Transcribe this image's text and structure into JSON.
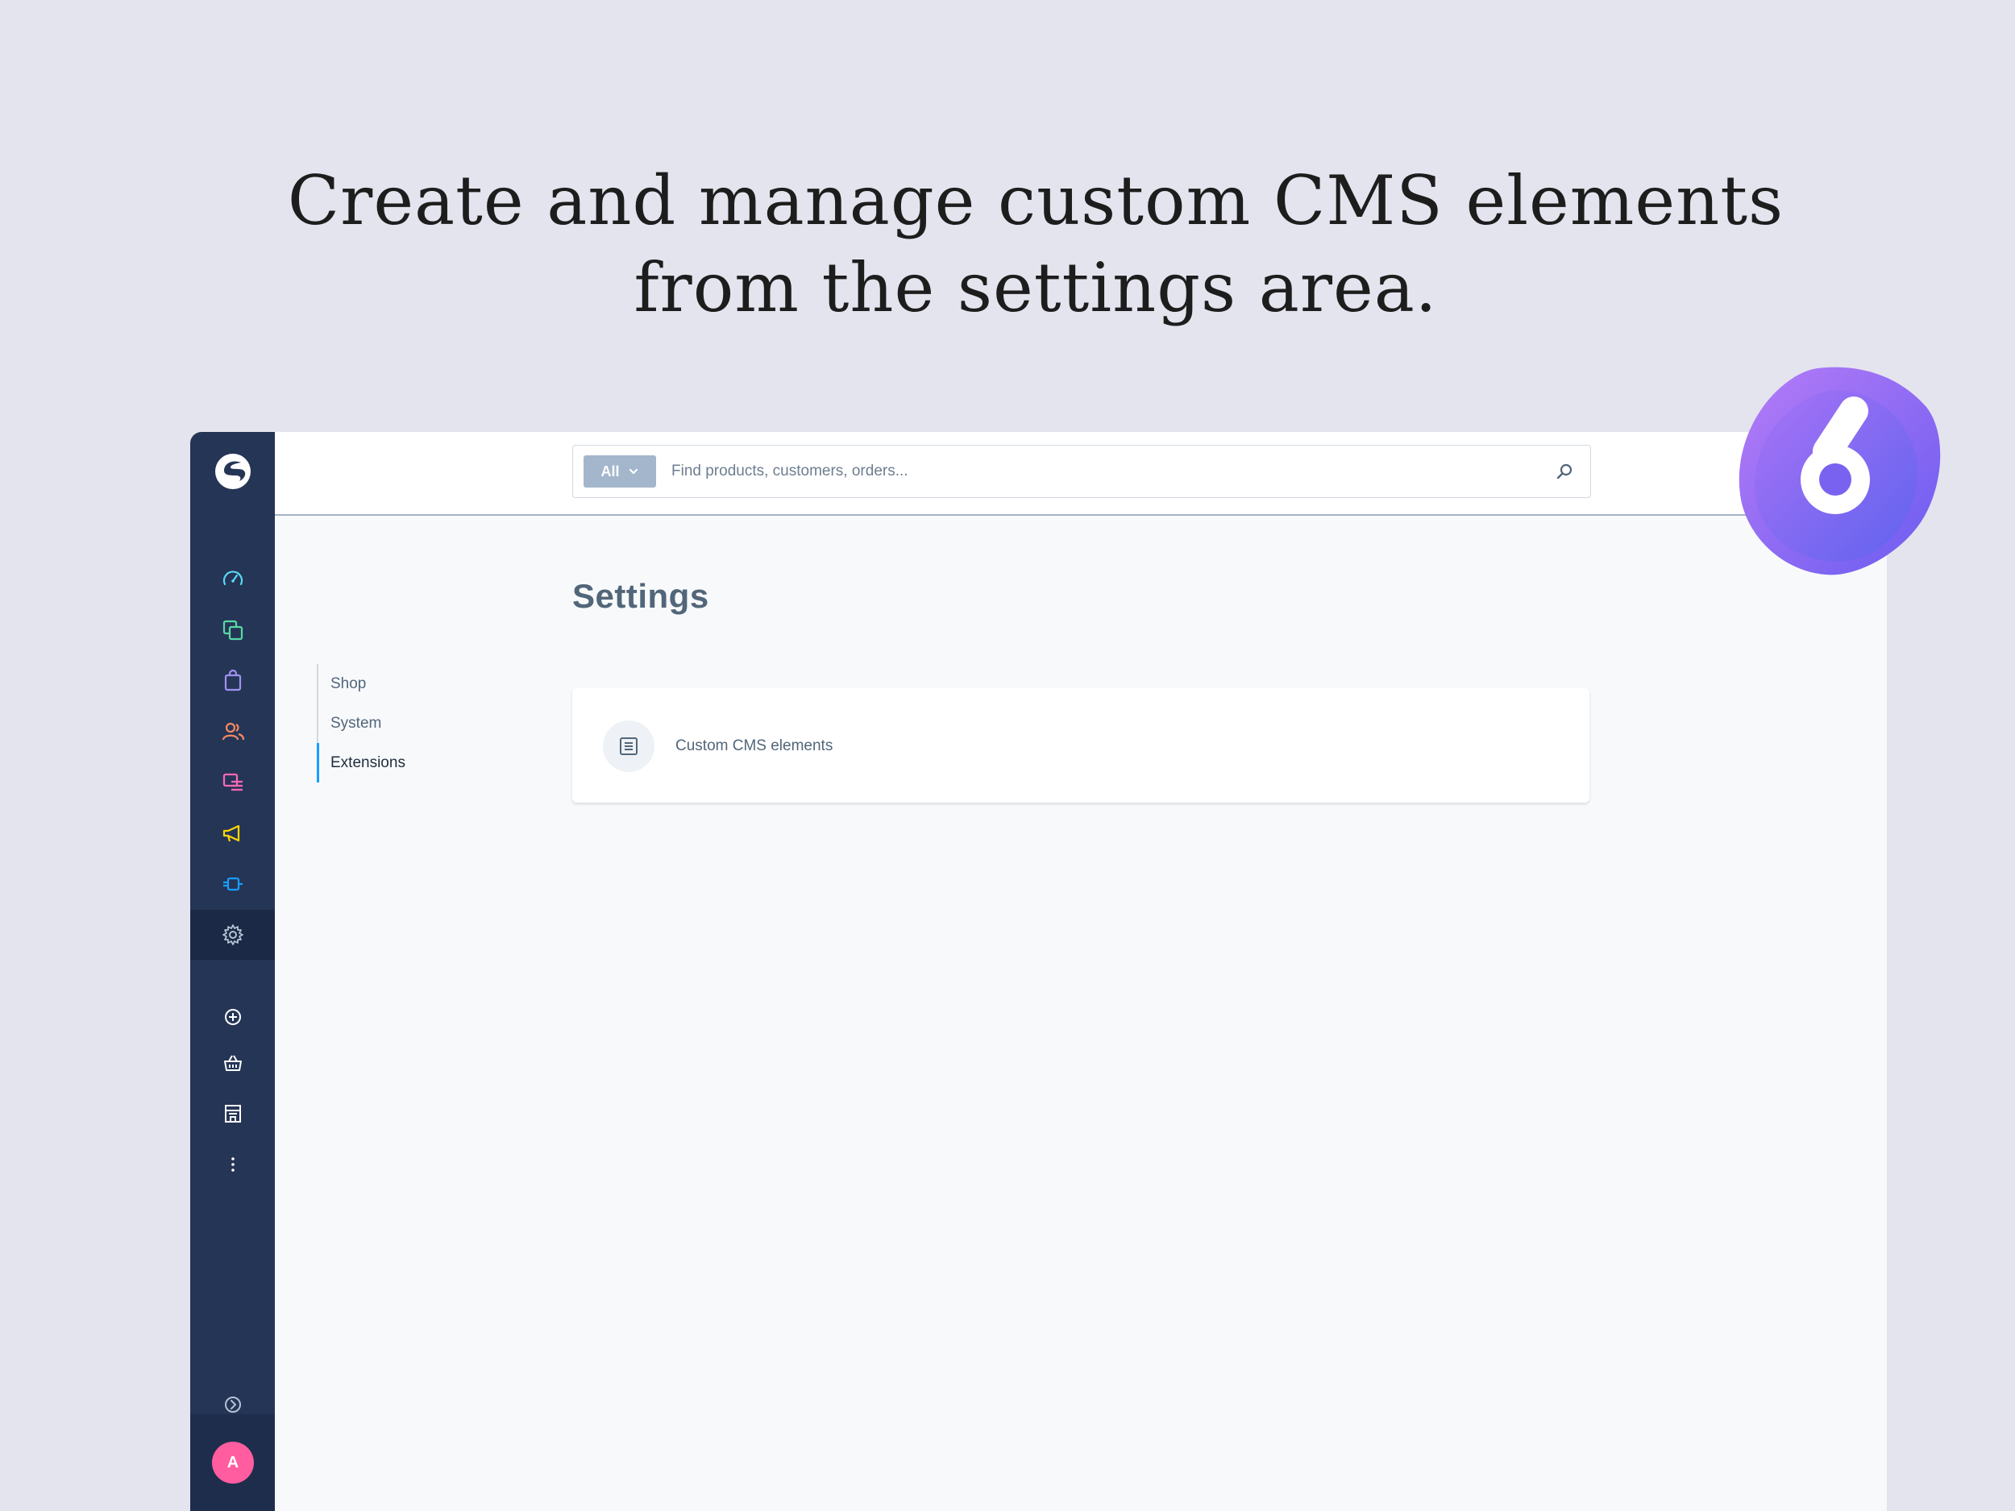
{
  "headline": {
    "line1": "Create and manage custom CMS elements",
    "line2": "from the settings area."
  },
  "badge": {
    "text": "6"
  },
  "sidebar": {
    "logo": "shopware-logo",
    "items": [
      {
        "icon": "dashboard-icon",
        "color": "#57d9f5"
      },
      {
        "icon": "catalogue-icon",
        "color": "#57d9a3"
      },
      {
        "icon": "orders-icon",
        "color": "#a092f0"
      },
      {
        "icon": "customers-icon",
        "color": "#f88962"
      },
      {
        "icon": "content-icon",
        "color": "#ff68b4"
      },
      {
        "icon": "marketing-icon",
        "color": "#ffd700"
      },
      {
        "icon": "extensions-icon",
        "color": "#189eff"
      },
      {
        "icon": "settings-icon",
        "color": "#b5c3d4",
        "active": true
      },
      {
        "icon": "add-icon",
        "color": "#ffffff"
      },
      {
        "icon": "basket-icon",
        "color": "#ffffff"
      },
      {
        "icon": "store-icon",
        "color": "#ffffff"
      },
      {
        "icon": "more-icon",
        "color": "#ffffff"
      }
    ],
    "collapse_icon": "chevron-circle-right-icon",
    "user_avatar": "A",
    "avatar_color": "#ff5da0"
  },
  "search": {
    "type_label": "All",
    "placeholder": "Find products, customers, orders..."
  },
  "page": {
    "title": "Settings"
  },
  "settings_nav": [
    {
      "label": "Shop"
    },
    {
      "label": "System"
    },
    {
      "label": "Extensions",
      "active": true
    }
  ],
  "card": {
    "items": [
      {
        "label": "Custom CMS elements",
        "icon": "document-icon"
      }
    ]
  }
}
